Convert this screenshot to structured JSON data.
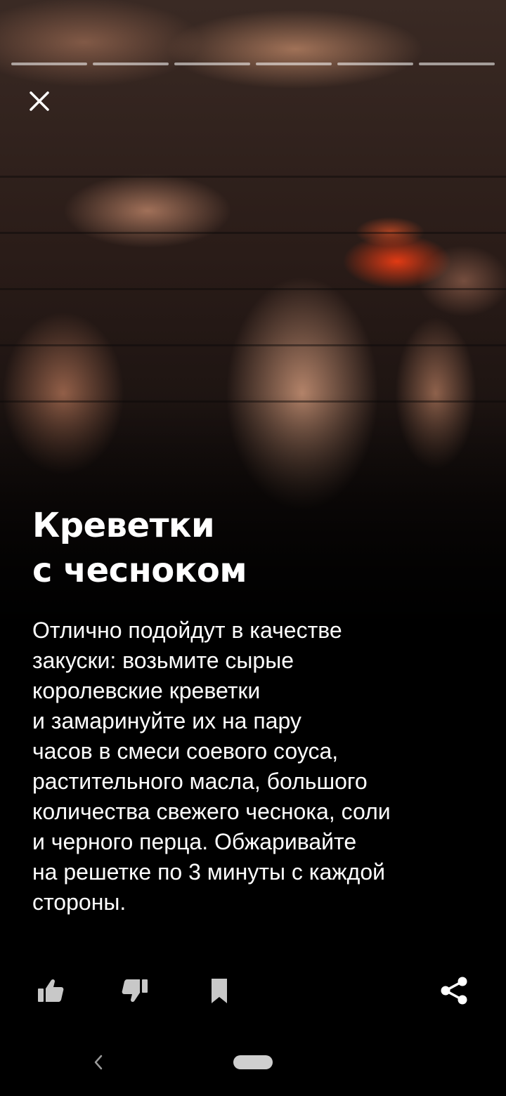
{
  "story": {
    "segments": 6,
    "title_lines": [
      "Креветки",
      "с чесноком"
    ],
    "body_lines": [
      "Отлично подойдут в качестве",
      "закуски: возьмите сырые",
      "королевские креветки",
      "и замаринуйте их на пару",
      "часов в смеси соевого соуса,",
      "растительного масла, большого",
      "количества свежего чеснока, соли",
      "и черного перца. Обжаривайте",
      "на решетке по 3 минуты с каждой",
      "стороны."
    ]
  },
  "icons": {
    "close": "close-icon",
    "like": "thumbs-up-icon",
    "dislike": "thumbs-down-icon",
    "bookmark": "bookmark-icon",
    "share": "share-icon",
    "nav_back": "chevron-left-icon"
  },
  "colors": {
    "background": "#000000",
    "text": "#ffffff",
    "icon_muted": "#c8c8c8",
    "progress": "rgba(255,255,255,0.55)"
  }
}
